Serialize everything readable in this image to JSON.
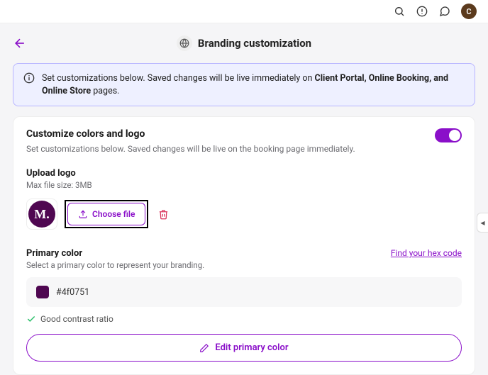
{
  "topbar": {
    "avatar_initial": "C"
  },
  "header": {
    "title": "Branding customization"
  },
  "banner": {
    "prefix": "Set customizations below. Saved changes will be live immediately on ",
    "bold": "Client Portal, Online Booking, and Online Store",
    "suffix": " pages."
  },
  "colors_card": {
    "title": "Customize colors and logo",
    "subtitle": "Set customizations below. Saved changes will be live on the booking page immediately."
  },
  "upload": {
    "label": "Upload logo",
    "hint": "Max file size: 3MB",
    "button": "Choose file",
    "logo_letter": "M."
  },
  "primary_color": {
    "label": "Primary color",
    "hint": "Select a primary color to represent your branding.",
    "hex_link": "Find your hex code",
    "hex_value": "#4f0751",
    "contrast_msg": "Good contrast ratio",
    "edit_button": "Edit primary color"
  }
}
